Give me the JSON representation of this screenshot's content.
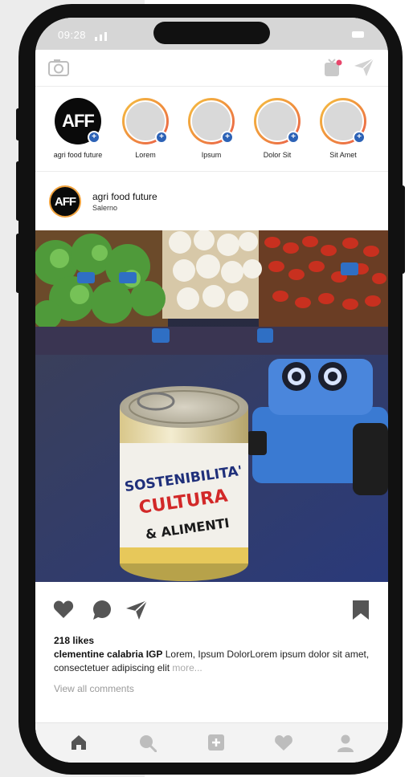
{
  "status_bar": {
    "time": "09:28"
  },
  "stories": [
    {
      "label": "agri food future",
      "avatar_text": "AFF",
      "own": true
    },
    {
      "label": "Lorem"
    },
    {
      "label": "Ipsum"
    },
    {
      "label": "Dolor Sit"
    },
    {
      "label": "Sit Amet"
    }
  ],
  "post": {
    "avatar_text": "AFF",
    "username": "agri food future",
    "location": "Salerno",
    "can_label": [
      "SOSTENIBILITA'",
      "CULTURA",
      "& ALIMENTI"
    ],
    "likes": "218 likes",
    "caption_user": "clementine calabria IGP",
    "caption_text": " Lorem, Ipsum DolorLorem ipsum dolor sit amet, consectetuer adipiscing elit ",
    "caption_more": "more...",
    "view_comments": "View all comments"
  },
  "colors": {
    "story_ring": "#f0923d",
    "add_badge": "#2c62b6",
    "icons": "#555555",
    "nav_icons": "#a8a8a8"
  },
  "icons": {
    "top_left": "camera-icon",
    "top_right": [
      "igtv-icon",
      "send-icon"
    ],
    "actions": [
      "heart-icon",
      "comment-icon",
      "send-icon",
      "bookmark-icon"
    ],
    "nav": [
      "home-icon",
      "search-icon",
      "add-post-icon",
      "heart-icon",
      "profile-icon"
    ]
  }
}
